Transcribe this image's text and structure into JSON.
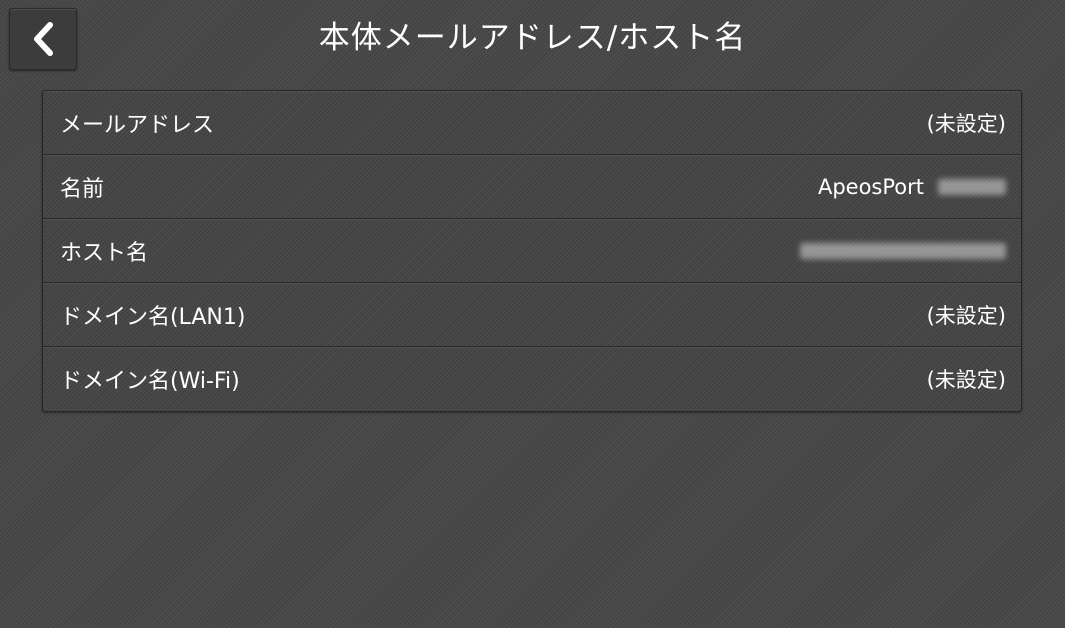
{
  "header": {
    "title": "本体メールアドレス/ホスト名",
    "back_icon": "chevron-left-icon"
  },
  "items": [
    {
      "label": "メールアドレス",
      "value": "(未設定)"
    },
    {
      "label": "名前",
      "value": "ApeosPort"
    },
    {
      "label": "ホスト名",
      "value": ""
    },
    {
      "label": "ドメイン名(LAN1)",
      "value": "(未設定)"
    },
    {
      "label": "ドメイン名(Wi-Fi)",
      "value": "(未設定)"
    }
  ]
}
